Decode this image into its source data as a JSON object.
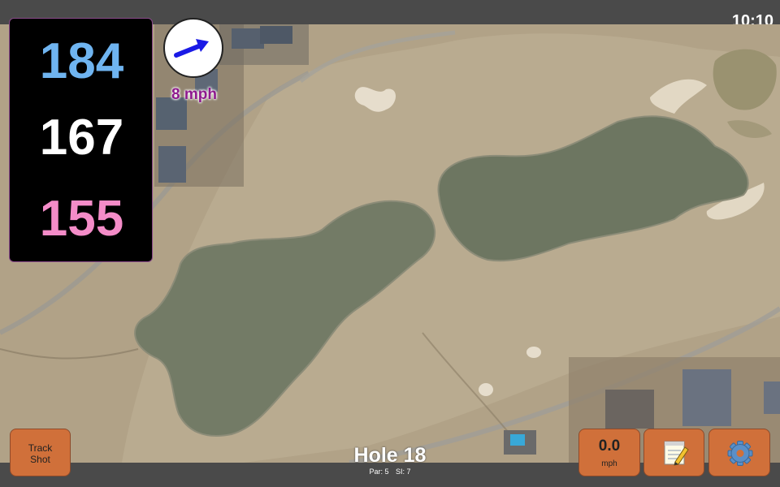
{
  "status": {
    "time": "10:10"
  },
  "distances": {
    "back": "184",
    "middle": "167",
    "front": "155"
  },
  "wind": {
    "speed": "8 mph",
    "icon": "arrow-icon",
    "arrow_color": "#1a1ae6"
  },
  "hole": {
    "title": "Hole 18",
    "par": "Par: 5",
    "stroke_index": "SI: 7"
  },
  "buttons": {
    "track_shot": [
      "Track",
      "Shot"
    ],
    "speed_value": "0.0",
    "speed_unit": "mph",
    "notes_icon": "notepad-icon",
    "settings_icon": "gear-icon"
  },
  "colors": {
    "back_distance": "#6fb4f0",
    "middle_distance": "#ffffff",
    "front_distance": "#f48cc8",
    "button": "#d0703a",
    "wind_label": "#8e1a8e"
  }
}
